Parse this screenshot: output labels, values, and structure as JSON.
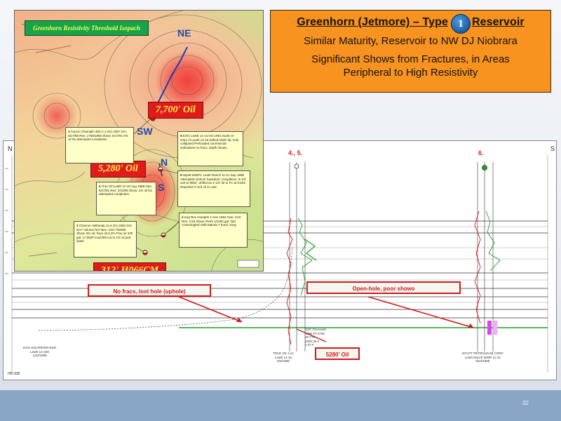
{
  "slide": {
    "title_left": "Greenhorn (Jetmore) – Type",
    "type_number": "1",
    "title_right": "Reservoir",
    "subtitle": "Similar Maturity, Reservoir to NW DJ Niobrara",
    "subtitle2_line1": "Significant Shows from Fractures, in Areas",
    "subtitle2_line2": "Peripheral to High Resistivity",
    "page_number": "32",
    "colors": {
      "title_box": "#f7931e",
      "badge": "#1d63ad",
      "footer": "#8aa6c6",
      "oil_tag": "#e01b1b"
    }
  },
  "map": {
    "title": "Greenhorn Resistivity Threshold Isopach",
    "compass": {
      "ne": "NE",
      "sw": "SW",
      "n": "N",
      "s": "S"
    },
    "oil_tags": [
      "7,700' Oil",
      "5,280' Oil",
      "312' H066CM"
    ],
    "callouts": [
      {
        "num": "1",
        "text": "Amoco Champlin 363 A-1 Oct 1987 Grs: 5/17/85 Res: 1708/1993 Show: 5/17/91 5% oil No attempted completion"
      },
      {
        "num": "5",
        "text": "EOG Leath 14-14 Oct 1991 North re-entry of Leath 14-16 Drilled 1500' lat, hole collapsed Perforated commercial indications no fracs, depth shows"
      },
      {
        "num": "4",
        "text": "True Oil Leath 14-15 Aug 1998 Gas: 5/17/91 Res: 2/10/95 Show: 1% oil No attempted completion"
      },
      {
        "num": "6",
        "text": "Wyatt WWPC Leath Ranch 11-21 Sep 1998 Attempted vertical 'backdoor' completion; 8-1/2' unit to 8652', drilled as 4-1/2' tie to TC at 8,532 Reported 3 m/d oil no rate"
      },
      {
        "num": "3",
        "text": "Chevron Velbonati 11-6 Oct 1982 Grs: 5/17 Volume N/A Res: 1/12 7/30/80 Show: 5% oil, fracs oil 5.2% Frac w/ 220 gal, 17,000# mod Brk-cut to 1/2 oil and water"
      },
      {
        "num": "2",
        "text": "Kog Rex Humphe 1 Nov 1984 Gas: 1/10 Res: 1/18 Show: Perfs 1/1000 gal, fold 'commingled' with Dakota 7 bond, Gray"
      }
    ]
  },
  "cross_section": {
    "left_label": "N",
    "right_label": "S",
    "well_numbers": [
      "4., 5.",
      "6."
    ],
    "annotations": {
      "no_fracs": "No fracs, lost hole (uphole)",
      "open_hole": "Open-hole, poor shows",
      "oil_5280": "5280' Oil"
    },
    "well_captions": {
      "left": [
        "EOG INCORPORATED",
        "Leath 14-15H",
        "12/4/1998"
      ],
      "middle": [
        "TRUE OIL LLC",
        "Leath 14-15",
        "8/3/1998"
      ],
      "right": [
        "WYATT PETROLEUM CORP",
        "Leath Ranch WWR 11-21",
        "9/23/1998"
      ]
    },
    "tops_note": [
      "OST Tool used",
      "5795 TF 5735",
      "38 TTF",
      "2000 25 0",
      "1 07 F"
    ],
    "corner_label": "HB-20B"
  }
}
